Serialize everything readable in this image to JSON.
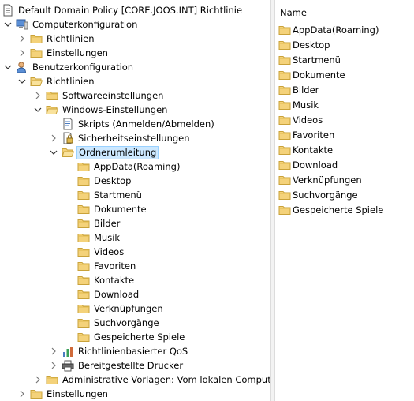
{
  "tree": {
    "root": "Default Domain Policy [CORE.JOOS.INT] Richtlinie",
    "computer": "Computerkonfiguration",
    "computer_policies": "Richtlinien",
    "computer_settings": "Einstellungen",
    "user": "Benutzerkonfiguration",
    "user_policies": "Richtlinien",
    "software_settings": "Softwareeinstellungen",
    "windows_settings": "Windows-Einstellungen",
    "scripts": "Skripts (Anmelden/Abmelden)",
    "security": "Sicherheitseinstellungen",
    "folder_redirection": "Ordnerumleitung",
    "redirect_folders": [
      "AppData(Roaming)",
      "Desktop",
      "Startmenü",
      "Dokumente",
      "Bilder",
      "Musik",
      "Videos",
      "Favoriten",
      "Kontakte",
      "Download",
      "Verknüpfungen",
      "Suchvorgänge",
      "Gespeicherte Spiele"
    ],
    "qos": "Richtlinienbasierter QoS",
    "printers": "Bereitgestellte Drucker",
    "admin_templates": "Administrative Vorlagen: Vom lokalen Computer a",
    "user_settings": "Einstellungen"
  },
  "list": {
    "column_header": "Name",
    "items": [
      "AppData(Roaming)",
      "Desktop",
      "Startmenü",
      "Dokumente",
      "Bilder",
      "Musik",
      "Videos",
      "Favoriten",
      "Kontakte",
      "Download",
      "Verknüpfungen",
      "Suchvorgänge",
      "Gespeicherte Spiele"
    ]
  },
  "colors": {
    "folder": "#e9c46a",
    "folder_edge": "#c9a23a",
    "selection": "#cce8ff",
    "selection_border": "#99d1ff"
  }
}
